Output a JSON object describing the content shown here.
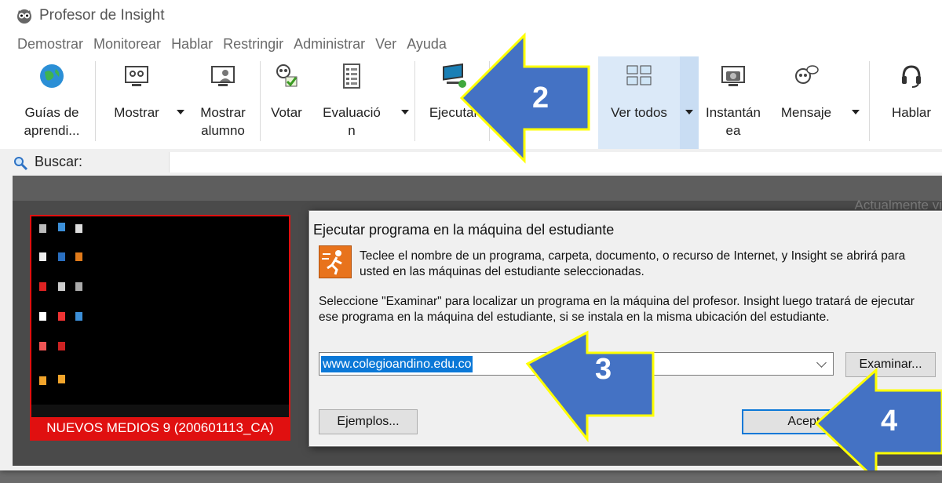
{
  "app": {
    "title": "Profesor de Insight"
  },
  "menu": [
    "Demostrar",
    "Monitorear",
    "Hablar",
    "Restringir",
    "Administrar",
    "Ver",
    "Ayuda"
  ],
  "ribbon": {
    "guides_l1": "Guías de",
    "guides_l2": "aprendi...",
    "show": "Mostrar",
    "show_student_l1": "Mostrar",
    "show_student_l2": "alumno",
    "vote": "Votar",
    "evaluation_l1": "Evaluació",
    "evaluation_l2": "n",
    "execute": "Ejecutar",
    "view_all": "Ver todos",
    "snapshot_l1": "Instantán",
    "snapshot_l2": "ea",
    "message": "Mensaje",
    "talk": "Hablar"
  },
  "search": {
    "label": "Buscar:"
  },
  "content": {
    "status_text": "Actualmente vi"
  },
  "student": {
    "caption": "NUEVOS MEDIOS 9 (200601113_CA)"
  },
  "dialog": {
    "title": "Ejecutar programa en la máquina del estudiante",
    "intro": "Teclee el nombre de un programa, carpeta, documento, o recurso de Internet, y Insight se abrirá para usted en las máquinas del estudiante seleccionadas.",
    "browse_info": "Seleccione \"Examinar\" para localizar un programa en la máquina del profesor. Insight luego tratará de ejecutar ese programa en la máquina del estudiante, si se instala en la misma ubicación del estudiante.",
    "input_value": "www.colegioandino.edu.co",
    "browse_button": "Examinar...",
    "examples_button": "Ejemplos...",
    "accept_button": "Aceptar"
  },
  "callouts": [
    "2",
    "3",
    "4"
  ],
  "colors": {
    "callout_fill": "#4472c4",
    "callout_border": "#ffff00",
    "selection": "#0b78d7",
    "student_border": "#e01010"
  }
}
